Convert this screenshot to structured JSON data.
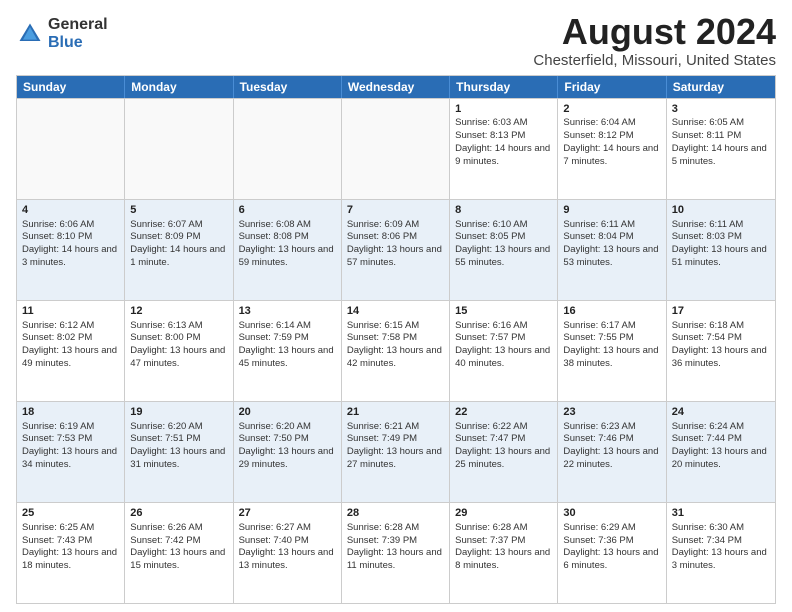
{
  "header": {
    "logo_general": "General",
    "logo_blue": "Blue",
    "title": "August 2024",
    "subtitle": "Chesterfield, Missouri, United States"
  },
  "weekdays": [
    "Sunday",
    "Monday",
    "Tuesday",
    "Wednesday",
    "Thursday",
    "Friday",
    "Saturday"
  ],
  "weeks": [
    [
      {
        "day": "",
        "sunrise": "",
        "sunset": "",
        "daylight": ""
      },
      {
        "day": "",
        "sunrise": "",
        "sunset": "",
        "daylight": ""
      },
      {
        "day": "",
        "sunrise": "",
        "sunset": "",
        "daylight": ""
      },
      {
        "day": "",
        "sunrise": "",
        "sunset": "",
        "daylight": ""
      },
      {
        "day": "1",
        "sunrise": "Sunrise: 6:03 AM",
        "sunset": "Sunset: 8:13 PM",
        "daylight": "Daylight: 14 hours and 9 minutes."
      },
      {
        "day": "2",
        "sunrise": "Sunrise: 6:04 AM",
        "sunset": "Sunset: 8:12 PM",
        "daylight": "Daylight: 14 hours and 7 minutes."
      },
      {
        "day": "3",
        "sunrise": "Sunrise: 6:05 AM",
        "sunset": "Sunset: 8:11 PM",
        "daylight": "Daylight: 14 hours and 5 minutes."
      }
    ],
    [
      {
        "day": "4",
        "sunrise": "Sunrise: 6:06 AM",
        "sunset": "Sunset: 8:10 PM",
        "daylight": "Daylight: 14 hours and 3 minutes."
      },
      {
        "day": "5",
        "sunrise": "Sunrise: 6:07 AM",
        "sunset": "Sunset: 8:09 PM",
        "daylight": "Daylight: 14 hours and 1 minute."
      },
      {
        "day": "6",
        "sunrise": "Sunrise: 6:08 AM",
        "sunset": "Sunset: 8:08 PM",
        "daylight": "Daylight: 13 hours and 59 minutes."
      },
      {
        "day": "7",
        "sunrise": "Sunrise: 6:09 AM",
        "sunset": "Sunset: 8:06 PM",
        "daylight": "Daylight: 13 hours and 57 minutes."
      },
      {
        "day": "8",
        "sunrise": "Sunrise: 6:10 AM",
        "sunset": "Sunset: 8:05 PM",
        "daylight": "Daylight: 13 hours and 55 minutes."
      },
      {
        "day": "9",
        "sunrise": "Sunrise: 6:11 AM",
        "sunset": "Sunset: 8:04 PM",
        "daylight": "Daylight: 13 hours and 53 minutes."
      },
      {
        "day": "10",
        "sunrise": "Sunrise: 6:11 AM",
        "sunset": "Sunset: 8:03 PM",
        "daylight": "Daylight: 13 hours and 51 minutes."
      }
    ],
    [
      {
        "day": "11",
        "sunrise": "Sunrise: 6:12 AM",
        "sunset": "Sunset: 8:02 PM",
        "daylight": "Daylight: 13 hours and 49 minutes."
      },
      {
        "day": "12",
        "sunrise": "Sunrise: 6:13 AM",
        "sunset": "Sunset: 8:00 PM",
        "daylight": "Daylight: 13 hours and 47 minutes."
      },
      {
        "day": "13",
        "sunrise": "Sunrise: 6:14 AM",
        "sunset": "Sunset: 7:59 PM",
        "daylight": "Daylight: 13 hours and 45 minutes."
      },
      {
        "day": "14",
        "sunrise": "Sunrise: 6:15 AM",
        "sunset": "Sunset: 7:58 PM",
        "daylight": "Daylight: 13 hours and 42 minutes."
      },
      {
        "day": "15",
        "sunrise": "Sunrise: 6:16 AM",
        "sunset": "Sunset: 7:57 PM",
        "daylight": "Daylight: 13 hours and 40 minutes."
      },
      {
        "day": "16",
        "sunrise": "Sunrise: 6:17 AM",
        "sunset": "Sunset: 7:55 PM",
        "daylight": "Daylight: 13 hours and 38 minutes."
      },
      {
        "day": "17",
        "sunrise": "Sunrise: 6:18 AM",
        "sunset": "Sunset: 7:54 PM",
        "daylight": "Daylight: 13 hours and 36 minutes."
      }
    ],
    [
      {
        "day": "18",
        "sunrise": "Sunrise: 6:19 AM",
        "sunset": "Sunset: 7:53 PM",
        "daylight": "Daylight: 13 hours and 34 minutes."
      },
      {
        "day": "19",
        "sunrise": "Sunrise: 6:20 AM",
        "sunset": "Sunset: 7:51 PM",
        "daylight": "Daylight: 13 hours and 31 minutes."
      },
      {
        "day": "20",
        "sunrise": "Sunrise: 6:20 AM",
        "sunset": "Sunset: 7:50 PM",
        "daylight": "Daylight: 13 hours and 29 minutes."
      },
      {
        "day": "21",
        "sunrise": "Sunrise: 6:21 AM",
        "sunset": "Sunset: 7:49 PM",
        "daylight": "Daylight: 13 hours and 27 minutes."
      },
      {
        "day": "22",
        "sunrise": "Sunrise: 6:22 AM",
        "sunset": "Sunset: 7:47 PM",
        "daylight": "Daylight: 13 hours and 25 minutes."
      },
      {
        "day": "23",
        "sunrise": "Sunrise: 6:23 AM",
        "sunset": "Sunset: 7:46 PM",
        "daylight": "Daylight: 13 hours and 22 minutes."
      },
      {
        "day": "24",
        "sunrise": "Sunrise: 6:24 AM",
        "sunset": "Sunset: 7:44 PM",
        "daylight": "Daylight: 13 hours and 20 minutes."
      }
    ],
    [
      {
        "day": "25",
        "sunrise": "Sunrise: 6:25 AM",
        "sunset": "Sunset: 7:43 PM",
        "daylight": "Daylight: 13 hours and 18 minutes."
      },
      {
        "day": "26",
        "sunrise": "Sunrise: 6:26 AM",
        "sunset": "Sunset: 7:42 PM",
        "daylight": "Daylight: 13 hours and 15 minutes."
      },
      {
        "day": "27",
        "sunrise": "Sunrise: 6:27 AM",
        "sunset": "Sunset: 7:40 PM",
        "daylight": "Daylight: 13 hours and 13 minutes."
      },
      {
        "day": "28",
        "sunrise": "Sunrise: 6:28 AM",
        "sunset": "Sunset: 7:39 PM",
        "daylight": "Daylight: 13 hours and 11 minutes."
      },
      {
        "day": "29",
        "sunrise": "Sunrise: 6:28 AM",
        "sunset": "Sunset: 7:37 PM",
        "daylight": "Daylight: 13 hours and 8 minutes."
      },
      {
        "day": "30",
        "sunrise": "Sunrise: 6:29 AM",
        "sunset": "Sunset: 7:36 PM",
        "daylight": "Daylight: 13 hours and 6 minutes."
      },
      {
        "day": "31",
        "sunrise": "Sunrise: 6:30 AM",
        "sunset": "Sunset: 7:34 PM",
        "daylight": "Daylight: 13 hours and 3 minutes."
      }
    ]
  ]
}
